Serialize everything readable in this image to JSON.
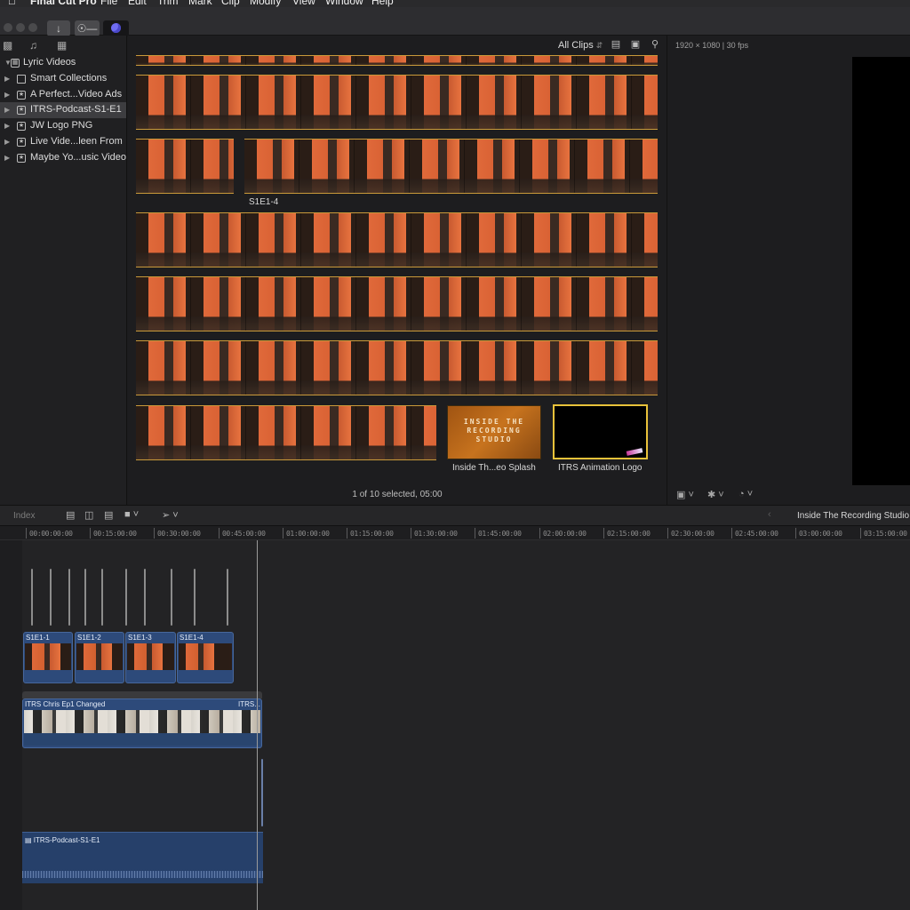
{
  "menubar": {
    "app_name": "Final Cut Pro",
    "items": [
      "File",
      "Edit",
      "Trim",
      "Mark",
      "Clip",
      "Modify",
      "View",
      "Window",
      "Help"
    ]
  },
  "toolbar": {
    "import_icon": "download-icon",
    "keywords_icon": "key-icon",
    "background_tasks_icon": "progress-circle-icon"
  },
  "sidebar": {
    "library_name": "Lyric Videos",
    "items": [
      {
        "label": "Smart Collections",
        "icon": "folder-icon"
      },
      {
        "label": "A Perfect...Video Ads",
        "icon": "event-icon"
      },
      {
        "label": "ITRS-Podcast-S1-E1",
        "icon": "event-icon",
        "selected": true
      },
      {
        "label": "JW Logo PNG",
        "icon": "event-icon"
      },
      {
        "label": "Live Vide...leen From",
        "icon": "event-icon"
      },
      {
        "label": "Maybe Yo...usic Video",
        "icon": "event-icon"
      }
    ]
  },
  "browser": {
    "filter": "All Clips",
    "clips": [
      {
        "label": "S1E1-4"
      },
      {
        "label": "Inside Th...eo Splash",
        "splash_text": [
          "INSIDE THE",
          "RECORDING",
          "STUDIO"
        ]
      },
      {
        "label": "ITRS Animation Logo"
      }
    ],
    "status": "1 of 10 selected, 05:00"
  },
  "viewer": {
    "format": "1920 × 1080 | 30 fps"
  },
  "timeline_toolbar": {
    "index_label": "Index",
    "project_name": "Inside The Recording Studio S"
  },
  "ruler": {
    "ticks": [
      "00:00:00:00",
      "00:15:00:00",
      "00:30:00:00",
      "00:45:00:00",
      "01:00:00:00",
      "01:15:00:00",
      "01:30:00:00",
      "01:45:00:00",
      "02:00:00:00",
      "02:15:00:00",
      "02:30:00:00",
      "02:45:00:00",
      "03:00:00:00",
      "03:15:00:00"
    ]
  },
  "timeline": {
    "connected_clips": [
      "S1E1-1",
      "S1E1-2",
      "S1E1-3",
      "S1E1-4"
    ],
    "primary_clip": "ITRS Chris Ep1 Changed",
    "primary_clip_tail": "ITRS...",
    "audio_clip": "ITRS-Podcast-S1-E1"
  }
}
